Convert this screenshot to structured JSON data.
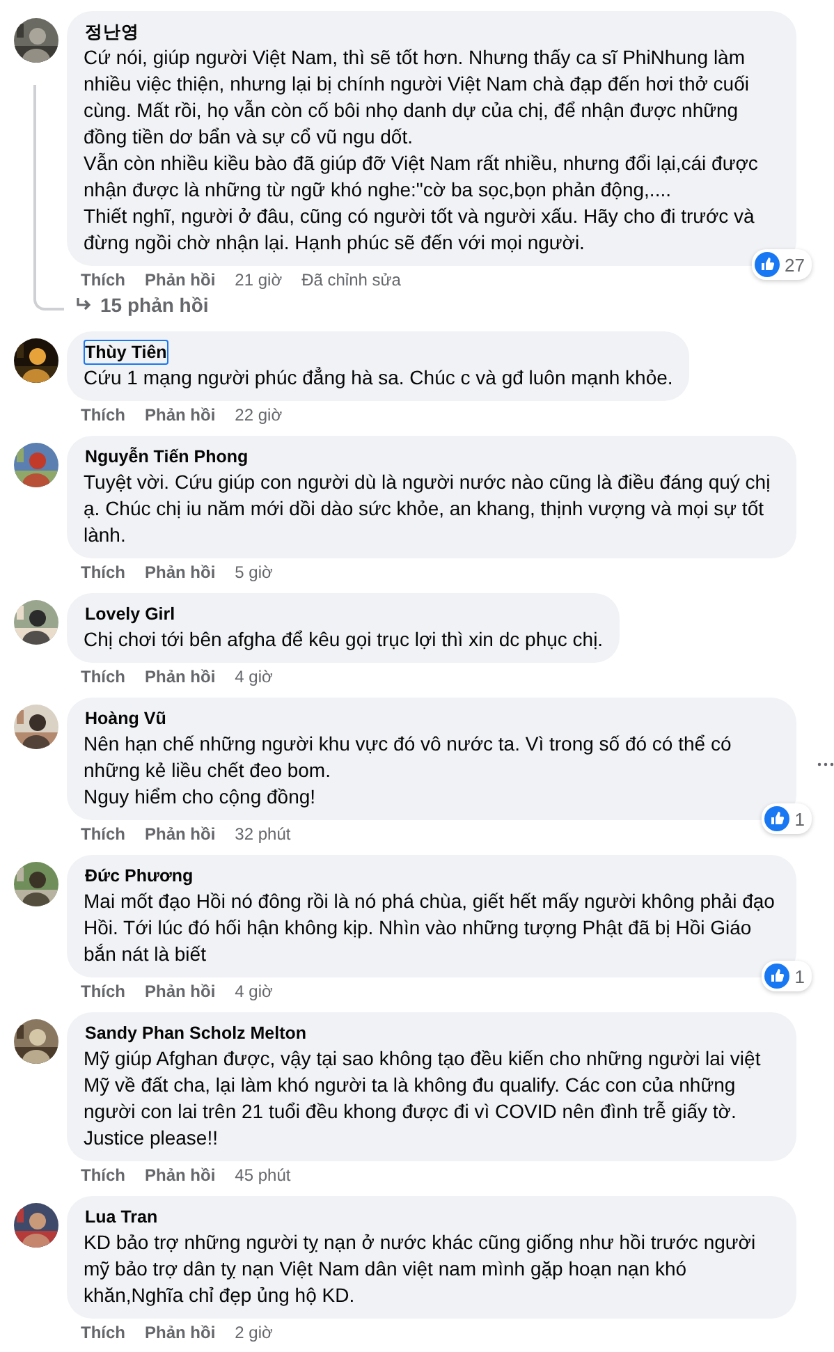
{
  "comments": [
    {
      "author": "정난영",
      "focused": false,
      "text": "Cứ nói, giúp người Việt Nam, thì sẽ tốt hơn. Nhưng thấy ca sĩ PhiNhung làm nhiều việc thiện, nhưng lại bị chính người Việt Nam chà đạp đến hơi thở cuối cùng. Mất rồi, họ vẫn còn cố bôi nhọ danh dự của chị, để nhận được những đồng tiền dơ bẩn và sự cổ vũ ngu dốt.\nVẫn còn nhiều kiều bào đã giúp đỡ Việt Nam rất nhiều, nhưng đổi lại,cái được nhận được là những từ ngữ khó nghe:\"cờ ba sọc,bọn phản động,....\nThiết nghĩ, người ở đâu, cũng có người tốt và người xấu. Hãy cho đi trước và đừng ngồi chờ nhận lại. Hạnh phúc sẽ đến với mọi người.",
      "like": "Thích",
      "reply": "Phản hồi",
      "time": "21 giờ",
      "edited": "Đã chỉnh sửa",
      "reactions": "27",
      "replies": "15 phản hồi",
      "more": false
    },
    {
      "author": "Thùy Tiên",
      "focused": true,
      "text": "Cứu 1 mạng người phúc đẳng hà sa. Chúc c và gđ luôn mạnh khỏe.",
      "like": "Thích",
      "reply": "Phản hồi",
      "time": "22 giờ",
      "more": false
    },
    {
      "author": "Nguyễn Tiến Phong",
      "focused": false,
      "text": "Tuyệt vời. Cứu giúp con người dù là người nước nào cũng là điều đáng quý chị ạ. Chúc chị iu năm mới dồi dào sức khỏe, an khang, thịnh vượng và mọi sự tốt lành.",
      "like": "Thích",
      "reply": "Phản hồi",
      "time": "5 giờ",
      "more": false
    },
    {
      "author": "Lovely Girl",
      "focused": false,
      "text": "Chị chơi tới bên afgha để kêu gọi trục lợi thì xin dc phục chị.",
      "like": "Thích",
      "reply": "Phản hồi",
      "time": "4 giờ",
      "more": false
    },
    {
      "author": "Hoàng Vũ",
      "focused": false,
      "text": "Nên hạn chế những người khu vực đó vô nước ta. Vì trong số đó có thể có những kẻ liều chết đeo bom.\nNguy hiểm cho cộng đồng!",
      "like": "Thích",
      "reply": "Phản hồi",
      "time": "32 phút",
      "reactions": "1",
      "more": true
    },
    {
      "author": "Đức Phương",
      "focused": false,
      "text": "Mai mốt đạo Hồi nó đông rồi là nó phá chùa, giết hết mấy người không phải đạo Hồi. Tới lúc đó hối hận không kịp. Nhìn vào những tượng Phật đã bị Hồi Giáo bắn nát là biết",
      "like": "Thích",
      "reply": "Phản hồi",
      "time": "4 giờ",
      "reactions": "1",
      "more": false
    },
    {
      "author": "Sandy Phan Scholz Melton",
      "focused": false,
      "text": "Mỹ giúp Afghan được, vậy tại sao không tạo đều kiến cho những người lai việt Mỹ về đất cha, lại làm khó người ta là không đu qualify. Các con của những người con lai trên 21 tuổi đều khong được đi vì COVID nên đình trễ giấy tờ. Justice please!!",
      "like": "Thích",
      "reply": "Phản hồi",
      "time": "45 phút",
      "more": false
    },
    {
      "author": "Lua Tran",
      "focused": false,
      "text": "KD bảo trợ những người tỵ nạn ở nước khác cũng giống như hồi trước người mỹ bảo trợ dân tỵ nạn Việt Nam dân việt nam mình gặp hoạn nạn khó khăn,Nghĩa chỉ đẹp ủng hộ KD.",
      "like": "Thích",
      "reply": "Phản hồi",
      "time": "2 giờ",
      "more": false
    }
  ]
}
